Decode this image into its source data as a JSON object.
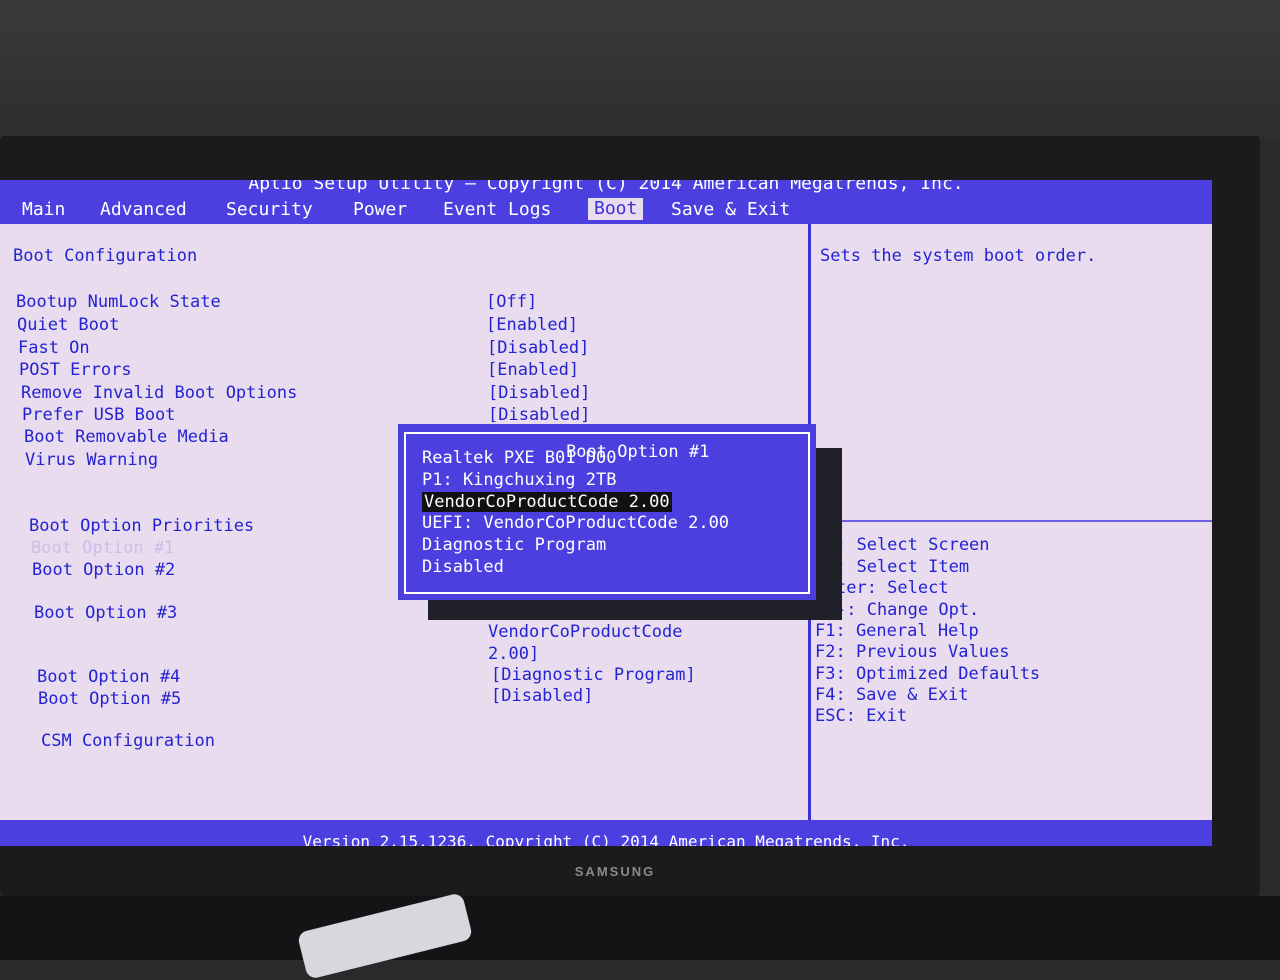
{
  "header": {
    "title": "Aptio Setup Utility – Copyright (C) 2014 American Megatrends, Inc.",
    "tabs": [
      "Main",
      "Advanced",
      "Security",
      "Power",
      "Event Logs",
      "Boot",
      "Save & Exit"
    ],
    "active_tab": "Boot"
  },
  "main": {
    "section_title": "Boot Configuration",
    "settings": [
      {
        "label": "Bootup NumLock State",
        "value": "[Off]"
      },
      {
        "label": "Quiet Boot",
        "value": "[Enabled]"
      },
      {
        "label": "Fast On",
        "value": "[Disabled]"
      },
      {
        "label": "POST Errors",
        "value": "[Enabled]"
      },
      {
        "label": "Remove Invalid Boot Options",
        "value": "[Disabled]"
      },
      {
        "label": "Prefer USB Boot",
        "value": "[Disabled]"
      },
      {
        "label": "Boot Removable Media",
        "value": ""
      },
      {
        "label": "Virus Warning",
        "value": ""
      }
    ],
    "priorities_title": "Boot Option Priorities",
    "boot_options": [
      {
        "label": "Boot Option #1",
        "value": ""
      },
      {
        "label": "Boot Option #2",
        "value": ""
      },
      {
        "label": "Boot Option #3",
        "value": "VendorCoProductCode",
        "value2": "2.00]"
      },
      {
        "label": "Boot Option #4",
        "value": "[Diagnostic Program]"
      },
      {
        "label": "Boot Option #5",
        "value": "[Disabled]"
      }
    ],
    "csm": "CSM Configuration"
  },
  "help": {
    "description": "Sets the system boot order.",
    "keys": [
      ": Select Screen",
      ": Select Item",
      "ter: Select",
      "-: Change Opt.",
      "F1: General Help",
      "F2: Previous Values",
      "F3: Optimized Defaults",
      "F4: Save & Exit",
      "ESC: Exit"
    ]
  },
  "popup": {
    "title": "Boot Option #1",
    "options": [
      "Realtek PXE B01 D00",
      "P1: Kingchuxing 2TB",
      "VendorCoProductCode 2.00",
      "UEFI: VendorCoProductCode 2.00",
      "Diagnostic Program",
      "Disabled"
    ],
    "selected_index": 2
  },
  "footer": {
    "version": "Version 2.15.1236. Copyright (C) 2014 American Megatrends, Inc."
  },
  "monitor": {
    "brand": "SAMSUNG"
  }
}
